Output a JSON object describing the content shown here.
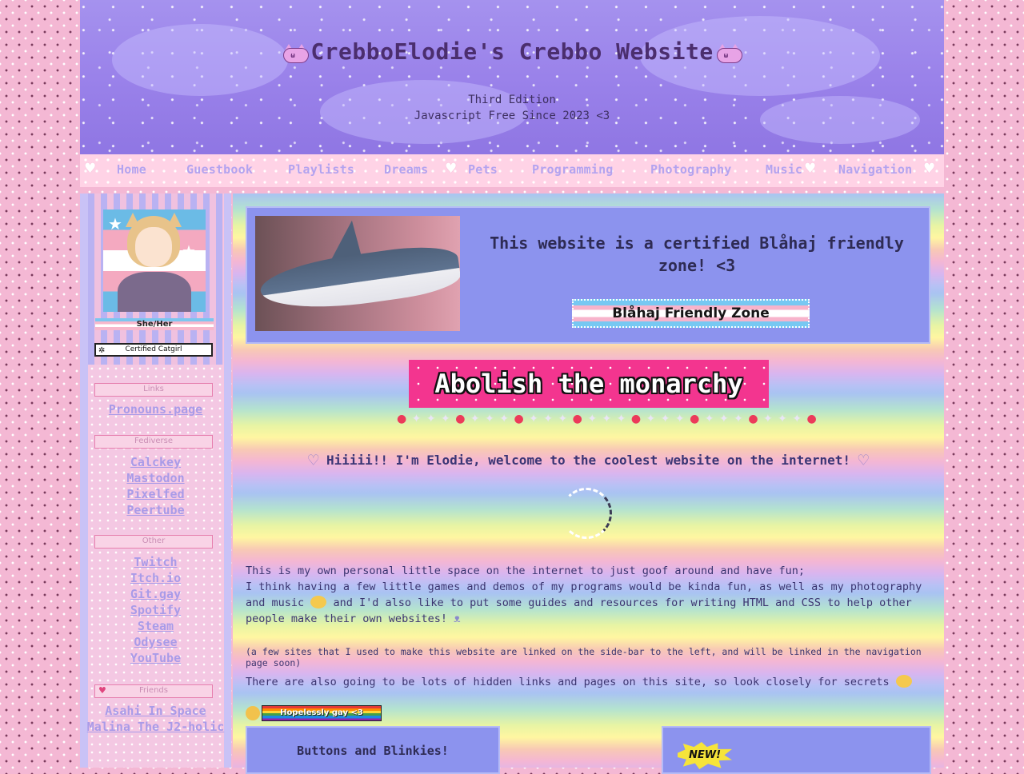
{
  "header": {
    "title": "CrebboElodie's Crebbo Website",
    "edition": "Third Edition",
    "tagline": "Javascript Free Since 2023 <3",
    "title_icon": "cat-face-icon"
  },
  "nav": {
    "items": [
      "Home",
      "Guestbook",
      "Playlists",
      "Dreams",
      "Pets",
      "Programming",
      "Photography",
      "Music",
      "Navigation"
    ],
    "heart_icon": "♥"
  },
  "sidebar": {
    "pronouns": "She/Her",
    "catgirl_badge": "Certified Catgirl",
    "sections": {
      "links": {
        "heading": "Links",
        "items": [
          "Pronouns.page"
        ]
      },
      "fediverse": {
        "heading": "Fediverse",
        "items": [
          "Calckey",
          "Mastodon",
          "Pixelfed",
          "Peertube"
        ]
      },
      "other": {
        "heading": "Other",
        "items": [
          "Twitch",
          "Itch.io",
          "Git.gay",
          "Spotify",
          "Steam",
          "Odysee",
          "YouTube"
        ]
      },
      "friends": {
        "heading": "Friends",
        "items": [
          "Asahi In Space",
          "Malina The J2-holic"
        ]
      }
    }
  },
  "main": {
    "blahaj_text": "This website is a certified Blåhaj friendly zone! <3",
    "blahaj_button": "Blåhaj Friendly Zone",
    "monarchy_banner": "Abolish the monarchy",
    "welcome": "Hiiiii!! I'm Elodie, welcome to the coolest website on the internet!",
    "intro_line1": "This is my own personal little space on the internet to just goof around and have fun;",
    "intro_line2a": "I think having a few little games and demos of my programs would be kinda fun, as well as my photography and music",
    "intro_line2b": "and I'd also like to put some guides and resources for writing HTML and CSS to help other people make their own websites!",
    "note": "(a few sites that I used to make this website are linked on the side-bar to the left, and will be linked in the navigation page soon)",
    "secrets": "There are also going to be lots of hidden links and pages on this site, so look closely for secrets",
    "gay_badge": "Hopelessly gay <3",
    "buttons_heading": "Buttons and Blinkies!",
    "new_badge": "NEW!"
  },
  "colors": {
    "accent": "#9b82ea",
    "nav_bg": "#ffd3e6",
    "panel": "#8c93ee",
    "link": "#a99be8",
    "banner": "#f3358f"
  }
}
